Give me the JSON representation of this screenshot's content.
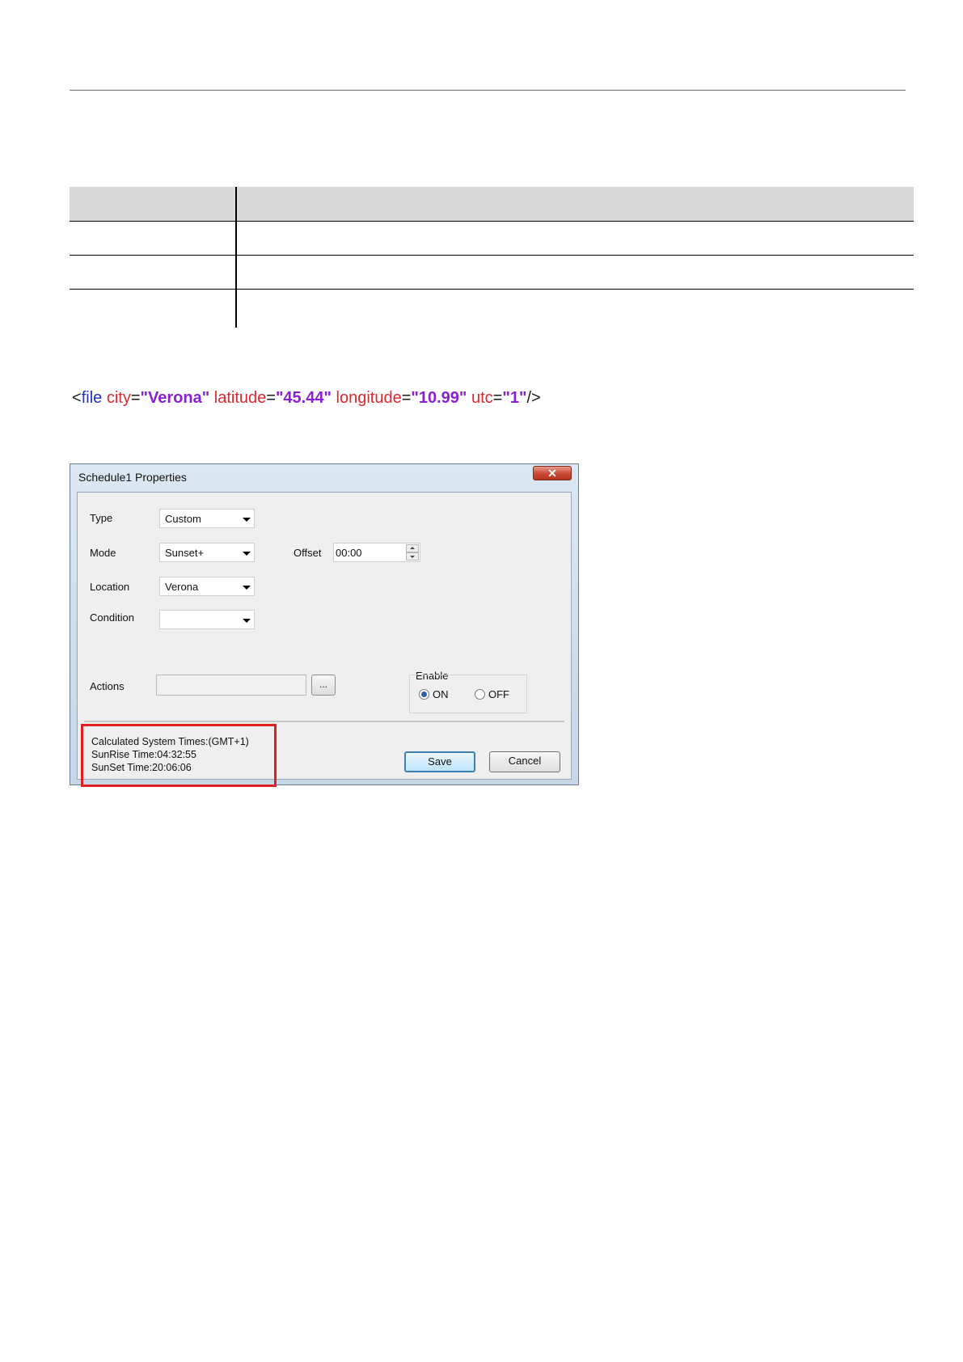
{
  "xml_snippet": {
    "open": "<",
    "tag": "file",
    "attrs": [
      {
        "name": "city",
        "eq": "=",
        "value": "\"Verona\""
      },
      {
        "name": "latitude",
        "eq": "=",
        "value": "\"45.44\""
      },
      {
        "name": "longitude",
        "eq": "=",
        "value": "\"10.99\""
      },
      {
        "name": "utc",
        "eq": "=",
        "value": "\"1\""
      }
    ],
    "close": "/>"
  },
  "dialog": {
    "title": "Schedule1 Properties",
    "close_glyph": "✕",
    "type_label": "Type",
    "type_value": "Custom",
    "mode_label": "Mode",
    "mode_value": "Sunset+",
    "offset_label": "Offset",
    "offset_value": "00:00",
    "location_label": "Location",
    "location_value": "Verona",
    "condition_label": "Condition",
    "condition_value": "",
    "actions_label": "Actions",
    "actions_browse": "...",
    "enable_label": "Enable",
    "on_label": "ON",
    "off_label": "OFF",
    "enabled": true,
    "calc_title": "Calculated System Times:(GMT+1)",
    "sunrise": "SunRise Time:04:32:55",
    "sunset": "SunSet Time:20:06:06",
    "save_label": "Save",
    "cancel_label": "Cancel"
  },
  "colors": {
    "tag": "#2233cc",
    "attr": "#e0262f",
    "value": "#8a1fd6",
    "highlight_box": "#e02020"
  }
}
